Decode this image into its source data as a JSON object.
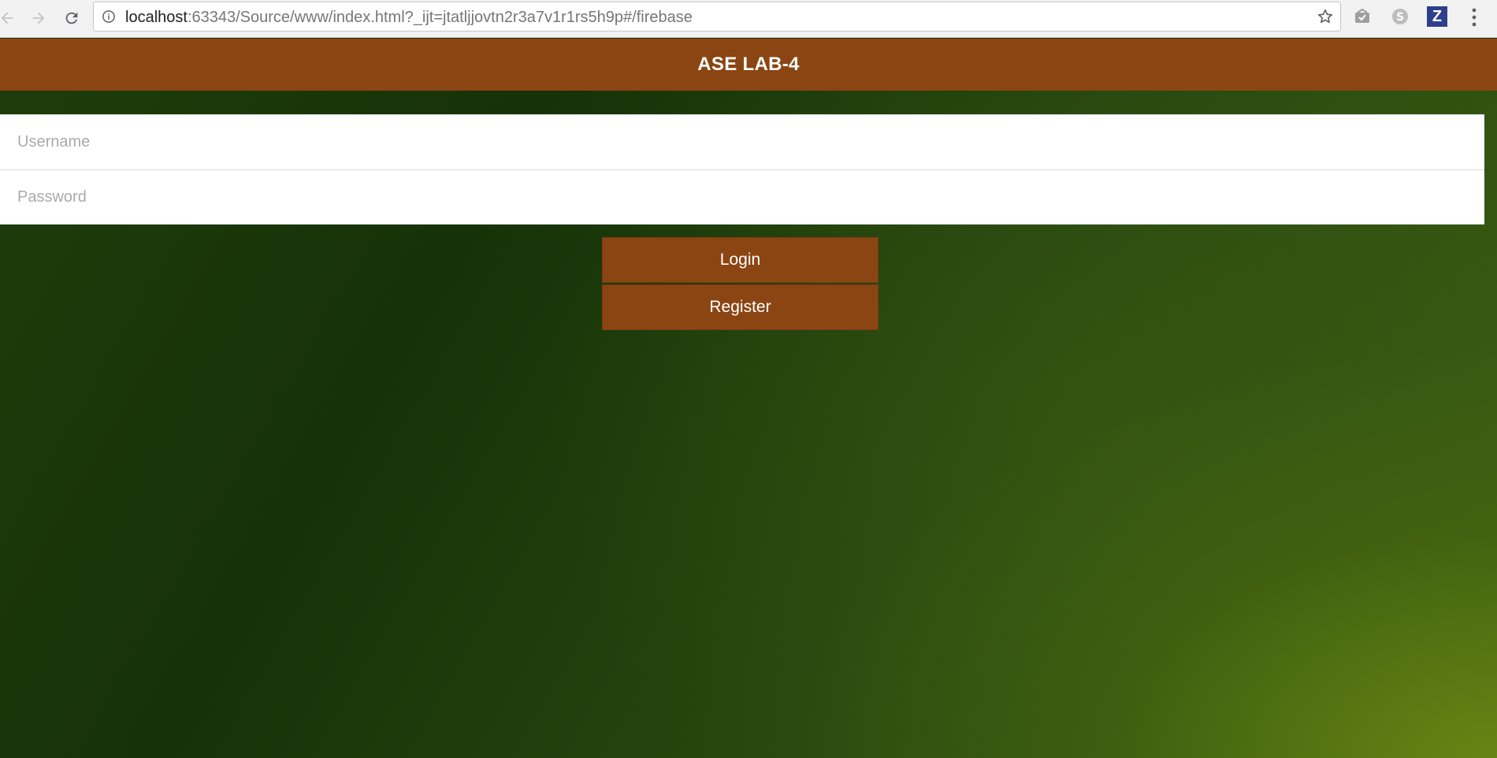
{
  "browser": {
    "url_host": "localhost",
    "url_rest": ":63343/Source/www/index.html?_ijt=jtatljjovtn2r3a7v1r1rs5h9p#/firebase",
    "icons": [
      "back-icon",
      "forward-icon",
      "reload-icon",
      "info-icon",
      "star-icon",
      "extension-icon",
      "skype-icon",
      "z-icon",
      "menu-icon"
    ],
    "z_extension_label": "Z"
  },
  "app": {
    "title": "ASE LAB-4",
    "header_color": "#8b4513"
  },
  "login_form": {
    "username_placeholder": "Username",
    "username_value": "",
    "password_placeholder": "Password",
    "password_value": ""
  },
  "buttons": {
    "login_label": "Login",
    "register_label": "Register"
  }
}
